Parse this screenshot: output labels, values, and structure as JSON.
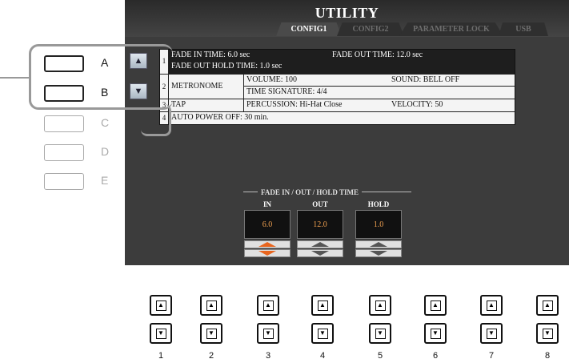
{
  "header": {
    "title": "UTILITY",
    "tabs": [
      {
        "label": "CONFIG1",
        "active": true
      },
      {
        "label": "CONFIG2",
        "active": false
      },
      {
        "label": "PARAMETER LOCK",
        "active": false
      },
      {
        "label": "USB",
        "active": false
      }
    ]
  },
  "side_buttons": [
    {
      "label": "A",
      "enabled": true
    },
    {
      "label": "B",
      "enabled": true
    },
    {
      "label": "C",
      "enabled": false
    },
    {
      "label": "D",
      "enabled": false
    },
    {
      "label": "E",
      "enabled": false
    }
  ],
  "table": {
    "rows": {
      "r1_num": "1",
      "r1_fade_in": "FADE IN TIME:  6.0 sec",
      "r1_fade_out": "FADE OUT TIME: 12.0 sec",
      "r1_hold": "FADE OUT HOLD TIME: 1.0 sec",
      "r2_num": "2",
      "r2_name": "METRONOME",
      "r2_volume": "VOLUME: 100",
      "r2_sound": "SOUND: BELL OFF",
      "r2_timesig": "TIME SIGNATURE:    4/4",
      "r3_num": "3",
      "r3_name": "TAP",
      "r3_percussion": "PERCUSSION: Hi-Hat Close",
      "r3_velocity": "VELOCITY: 50",
      "r4_num": "4",
      "r4_autopower": "AUTO POWER OFF: 30 min."
    }
  },
  "fade_section": {
    "heading": "FADE IN / OUT / HOLD TIME",
    "columns": [
      {
        "label": "IN",
        "value": "6.0"
      },
      {
        "label": "OUT",
        "value": "12.0"
      },
      {
        "label": "HOLD",
        "value": "1.0"
      }
    ]
  },
  "bottom_buttons": [
    "1",
    "2",
    "3",
    "4",
    "5",
    "6",
    "7",
    "8"
  ],
  "colors": {
    "screen_bg": "#3c3c3c",
    "value_text": "#f0a050",
    "accent_orange": "#e8651e"
  }
}
